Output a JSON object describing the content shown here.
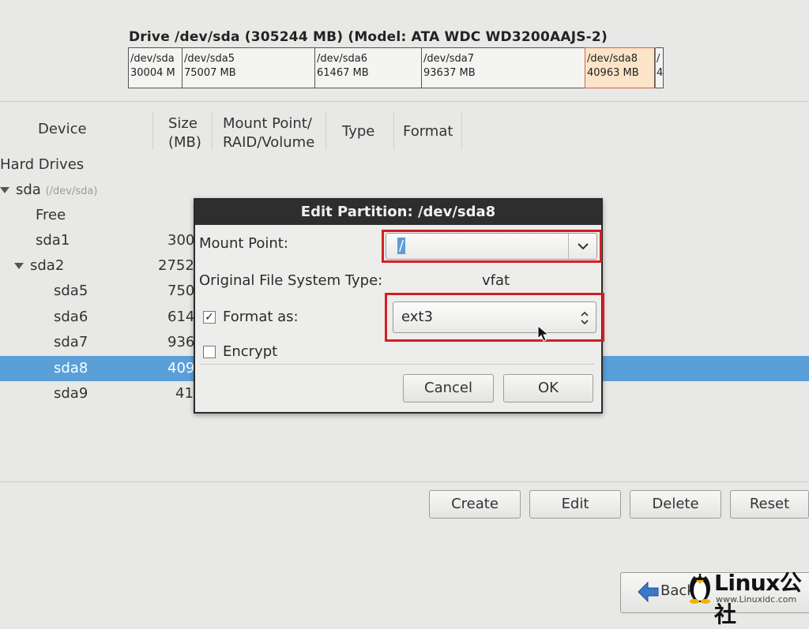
{
  "drive": {
    "title": "Drive /dev/sda (305244 MB) (Model: ATA WDC WD3200AAJS-2)",
    "segments": [
      {
        "name": "/dev/sda",
        "size": "30004 M"
      },
      {
        "name": "/dev/sda5",
        "size": "75007 MB"
      },
      {
        "name": "/dev/sda6",
        "size": "61467 MB"
      },
      {
        "name": "/dev/sda7",
        "size": "93637 MB"
      },
      {
        "name": "/dev/sda8",
        "size": "40963 MB"
      },
      {
        "name": "/",
        "size": "4"
      }
    ]
  },
  "table": {
    "headers": {
      "device": "Device",
      "size_line1": "Size",
      "size_line2": "(MB)",
      "mount_line1": "Mount Point/",
      "mount_line2": "RAID/Volume",
      "type": "Type",
      "format": "Format"
    },
    "group": "Hard Drives",
    "rows": [
      {
        "name": "sda",
        "hint": "(/dev/sda)",
        "size": ""
      },
      {
        "name": "Free",
        "size": ""
      },
      {
        "name": "sda1",
        "size": "300"
      },
      {
        "name": "sda2",
        "size": "2752"
      },
      {
        "name": "sda5",
        "size": "750"
      },
      {
        "name": "sda6",
        "size": "614"
      },
      {
        "name": "sda7",
        "size": "936"
      },
      {
        "name": "sda8",
        "size": "409"
      },
      {
        "name": "sda9",
        "size": "41"
      }
    ]
  },
  "dialog": {
    "title": "Edit Partition: /dev/sda8",
    "mount_point_label": "Mount Point:",
    "mount_point_value": "/",
    "orig_fs_label": "Original File System Type:",
    "orig_fs_value": "vfat",
    "format_as_label": "Format as:",
    "format_as_checked": true,
    "format_as_value": "ext3",
    "encrypt_label": "Encrypt",
    "encrypt_checked": false,
    "cancel_label": "Cancel",
    "ok_label": "OK"
  },
  "actions": {
    "create": "Create",
    "edit": "Edit",
    "delete": "Delete",
    "reset": "Reset"
  },
  "nav": {
    "back": "Back"
  },
  "watermark": {
    "brand": "Linux公社",
    "url": "www.Linuxidc.com"
  },
  "colors": {
    "selection": "#5a9fd8",
    "highlight_box": "#d21f26",
    "dialog_title_bg": "#2e2e2e"
  }
}
